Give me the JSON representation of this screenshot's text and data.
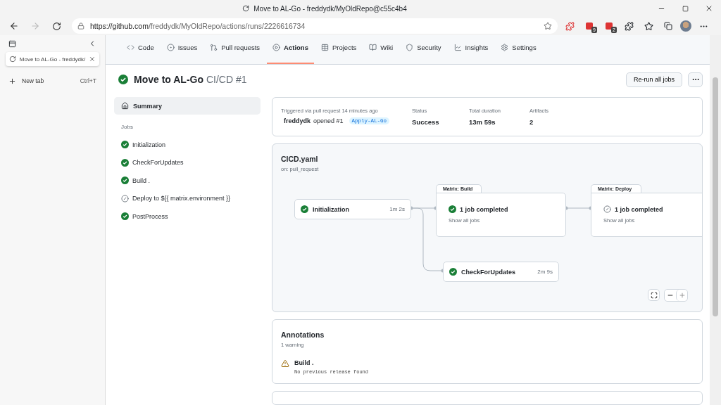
{
  "window": {
    "title": "Move to AL-Go - freddydk/MyOldRepo@c55c4b4"
  },
  "toolbar": {
    "address_host": "https://github.com",
    "address_path": "/freddydk/MyOldRepo/actions/runs/2226616734",
    "forward_disabled": true,
    "extension_badges": [
      "9",
      "2"
    ]
  },
  "vertical_tabs": {
    "tabs": [
      {
        "title": "Move to AL-Go - freddydk/",
        "selected": true
      }
    ],
    "new_tab": {
      "label": "New tab",
      "shortcut": "Ctrl+T"
    }
  },
  "repo_nav": [
    {
      "label": "Code",
      "selected": false
    },
    {
      "label": "Issues",
      "selected": false
    },
    {
      "label": "Pull requests",
      "selected": false
    },
    {
      "label": "Actions",
      "selected": true
    },
    {
      "label": "Projects",
      "selected": false
    },
    {
      "label": "Wiki",
      "selected": false
    },
    {
      "label": "Security",
      "selected": false
    },
    {
      "label": "Insights",
      "selected": false
    },
    {
      "label": "Settings",
      "selected": false
    }
  ],
  "run": {
    "title": "Move to AL-Go",
    "subtitle": "CI/CD #1",
    "kind": "success",
    "buttons": [
      "Re-run all jobs"
    ]
  },
  "sidebar": {
    "summary": {
      "label": "Summary",
      "selected": true
    },
    "jobs_heading": "Jobs",
    "jobs": [
      {
        "name": "Initialization",
        "kind": "success",
        "selected": false
      },
      {
        "name": "CheckForUpdates",
        "kind": "success",
        "selected": false
      },
      {
        "name": "Build .",
        "kind": "success",
        "selected": false
      },
      {
        "name": "Deploy to ${{ matrix.environment }}",
        "kind": "skipped",
        "selected": false
      },
      {
        "name": "PostProcess",
        "kind": "success",
        "selected": false
      }
    ]
  },
  "summary_card": {
    "trigger": "Triggered via pull request 14 minutes ago",
    "actor": "freddydk",
    "action": "opened #1",
    "branch": "Apply-AL-Go",
    "fields": [
      {
        "label": "Status",
        "value": "Success"
      },
      {
        "label": "Total duration",
        "value": "13m 59s"
      },
      {
        "label": "Artifacts",
        "value": "2"
      }
    ]
  },
  "workflow": {
    "file": "CICD.yaml",
    "trigger": "on: pull_request",
    "jobs": [
      {
        "kind": "success",
        "name": "Initialization",
        "duration": "1m 2s"
      },
      {
        "kind": "success",
        "name": "CheckForUpdates",
        "duration": "2m 9s"
      }
    ],
    "matrices": [
      {
        "kind": "success",
        "header": "Matrix: Build",
        "name": "1 job completed",
        "link": "Show all jobs"
      },
      {
        "kind": "skipped",
        "header": "Matrix: Deploy",
        "name": "1 job completed",
        "link": "Show all jobs"
      }
    ]
  },
  "annotations": {
    "title": "Annotations",
    "count": "1 warning",
    "items": [
      {
        "kind": "warning",
        "title": "Build .",
        "message": "No previous release found"
      }
    ]
  }
}
